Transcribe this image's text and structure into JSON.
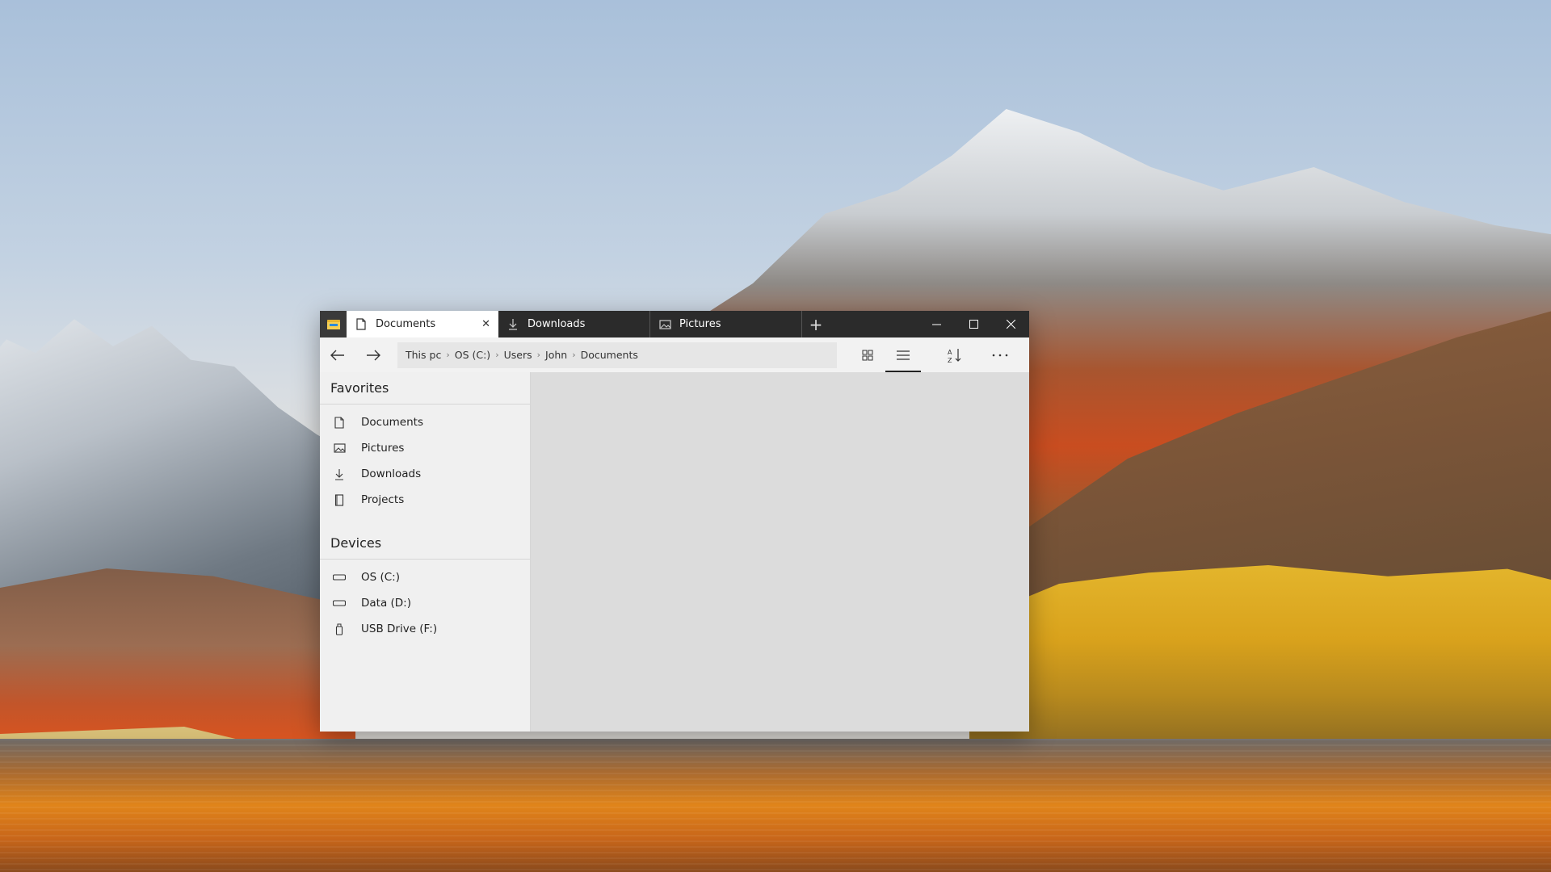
{
  "window": {
    "tabs": [
      {
        "label": "Documents",
        "icon": "document-icon",
        "active": true
      },
      {
        "label": "Downloads",
        "icon": "download-icon",
        "active": false
      },
      {
        "label": "Pictures",
        "icon": "picture-icon",
        "active": false
      }
    ],
    "new_tab": "+",
    "controls": {
      "minimize": "—",
      "maximize": "☐",
      "close": "✕"
    }
  },
  "toolbar": {
    "breadcrumb": [
      "This pc",
      "OS (C:)",
      "Users",
      "John",
      "Documents"
    ],
    "view": "list"
  },
  "sidebar": {
    "favorites_title": "Favorites",
    "favorites": [
      {
        "label": "Documents",
        "icon": "document-icon"
      },
      {
        "label": "Pictures",
        "icon": "picture-icon"
      },
      {
        "label": "Downloads",
        "icon": "download-icon"
      },
      {
        "label": "Projects",
        "icon": "project-icon"
      }
    ],
    "devices_title": "Devices",
    "devices": [
      {
        "label": "OS (C:)",
        "icon": "drive-icon"
      },
      {
        "label": "Data (D:)",
        "icon": "drive-icon"
      },
      {
        "label": "USB Drive (F:)",
        "icon": "usb-drive-icon"
      }
    ]
  },
  "colors": {
    "titlebar": "#2b2b2b",
    "active_tab": "#ffffff",
    "toolbar": "#f2f2f2",
    "sidebar": "#f0f0f0",
    "content": "#dcdcdc"
  }
}
